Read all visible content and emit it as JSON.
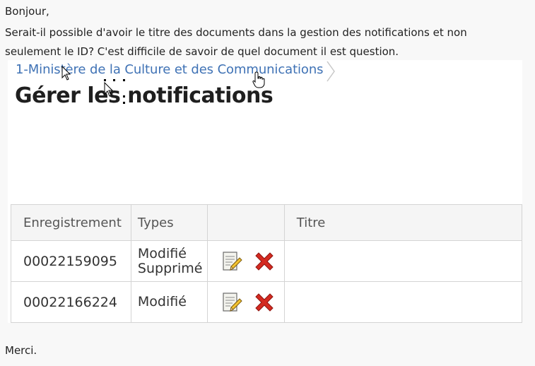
{
  "post": {
    "greeting": "Bonjour,",
    "body": "Serait-il possible d'avoir le titre des documents dans la gestion des notifications et non seulement le ID? C'est difficile de savoir de quel document il est question.",
    "closing": "Merci."
  },
  "screenshot": {
    "breadcrumb": "1-Ministère de la Culture et des Communications",
    "title": "Gérer les notifications",
    "table": {
      "headers": [
        "Enregistrement",
        "Types",
        "",
        "Titre"
      ],
      "rows": [
        {
          "id": "00022159095",
          "types": [
            "Modifié",
            "Supprimé"
          ],
          "title": ""
        },
        {
          "id": "00022166224",
          "types": [
            "Modifié"
          ],
          "title": ""
        }
      ]
    },
    "icons": {
      "edit": "edit-note-icon",
      "delete": "delete-x-icon",
      "cursor_arrow": "arrow-cursor-icon",
      "cursor_hand": "hand-cursor-icon"
    },
    "colors": {
      "link": "#3f72b5",
      "delete": "#d42a20"
    }
  }
}
